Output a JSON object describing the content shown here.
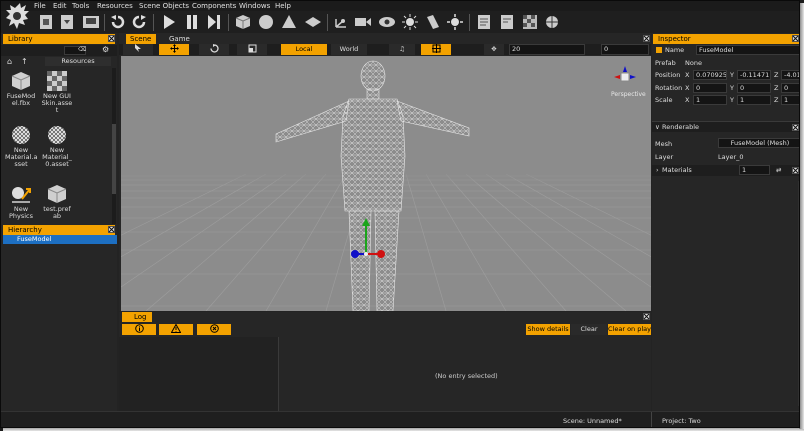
{
  "menu": [
    "File",
    "Edit",
    "Tools",
    "Resources",
    "Scene Objects",
    "Components",
    "Windows",
    "Help"
  ],
  "library": {
    "tab": "Library",
    "resources_tab": "Resources",
    "assets": [
      {
        "name": "FuseMod el.fbx",
        "icon": "cube-icon"
      },
      {
        "name": "New GUI Skin.asse t",
        "icon": "checker-icon"
      },
      {
        "name": "New Material.a sset",
        "icon": "material-sphere-icon"
      },
      {
        "name": "New Material_ 0.asset",
        "icon": "material-sphere-icon"
      },
      {
        "name": "New Physics",
        "icon": "physics-icon"
      },
      {
        "name": "test.pref ab",
        "icon": "prefab-cube-icon"
      }
    ]
  },
  "hierarchy": {
    "tab": "Hierarchy",
    "items": [
      "FuseModel"
    ]
  },
  "scene": {
    "tabs": [
      "Scene",
      "Game"
    ],
    "local_label": "Local",
    "world_label": "World",
    "snap_value": "20",
    "angle_value": "0",
    "perspective_label": "Perspective"
  },
  "log": {
    "tab": "Log",
    "show_details": "Show details",
    "clear": "Clear",
    "clear_on_play": "Clear on play",
    "empty_text": "(No entry selected)"
  },
  "inspector": {
    "tab": "Inspector",
    "name_label": "Name",
    "name_value": "FuseModel",
    "prefab_label": "Prefab",
    "prefab_value": "None",
    "position_label": "Position",
    "position": {
      "x": "0.070925",
      "y": "-0.11471",
      "z": "-4.012"
    },
    "rotation_label": "Rotation",
    "rotation": {
      "x": "0",
      "y": "0",
      "z": "0"
    },
    "scale_label": "Scale",
    "scale": {
      "x": "1",
      "y": "1",
      "z": "1"
    },
    "x": "X",
    "y": "Y",
    "z": "Z",
    "renderable_label": "Renderable",
    "mesh_label": "Mesh",
    "mesh_value": "FuseModel (Mesh)",
    "layer_label": "Layer",
    "layer_value": "Layer_0",
    "materials_label": "Materials",
    "materials_count": "1"
  },
  "status": {
    "scene": "Scene: Unnamed*",
    "project": "Project: Two"
  },
  "colors": {
    "accent": "#f3a200",
    "viewport": "#8c8c8c",
    "background": "#232323"
  }
}
